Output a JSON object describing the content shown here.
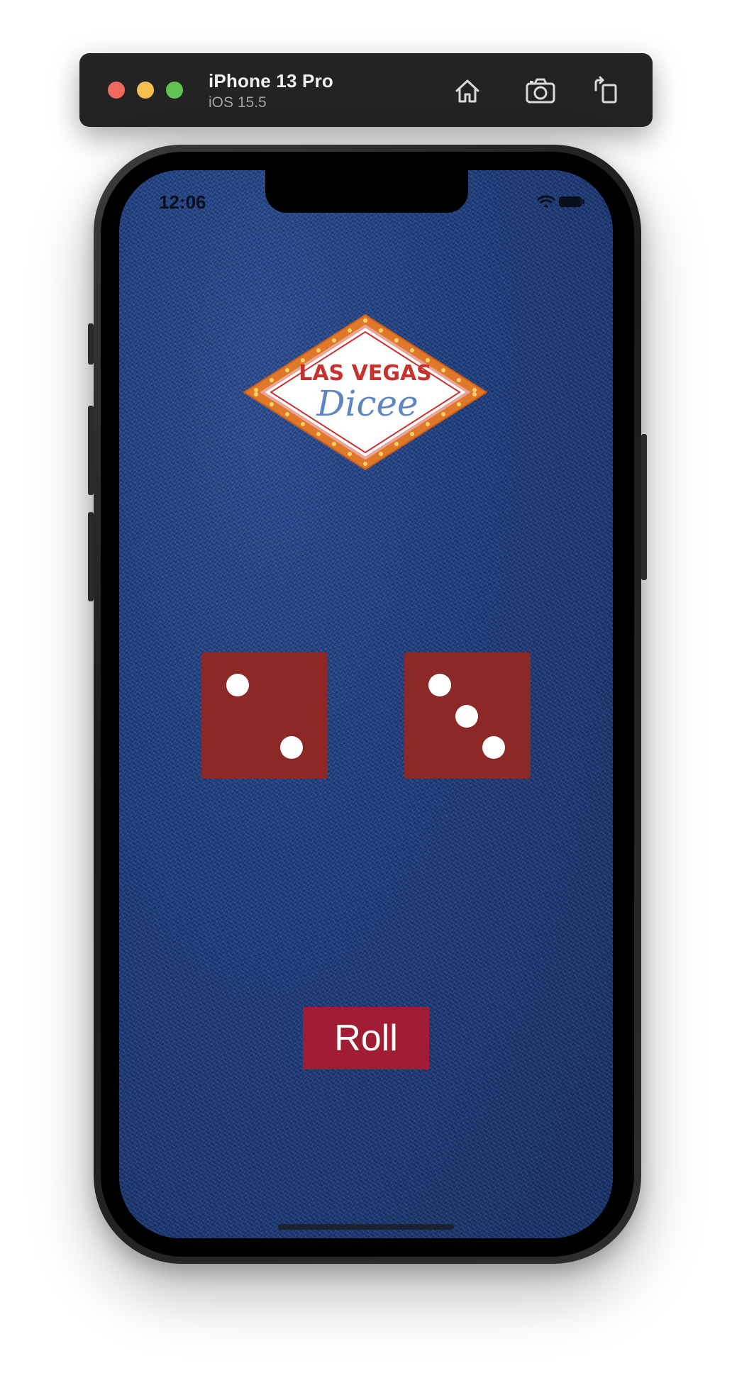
{
  "toolbar": {
    "device_name": "iPhone 13 Pro",
    "os_version": "iOS 15.5",
    "window_controls": [
      {
        "name": "close",
        "color": "#ed6a5e"
      },
      {
        "name": "minimize",
        "color": "#f5bf4f"
      },
      {
        "name": "zoom",
        "color": "#61c554"
      }
    ],
    "actions": [
      {
        "icon": "home-icon",
        "action": "Home"
      },
      {
        "icon": "camera-icon",
        "action": "Screenshot"
      },
      {
        "icon": "rotate-icon",
        "action": "Rotate"
      }
    ]
  },
  "status_bar": {
    "time": "12:06",
    "icons": [
      "wifi-icon",
      "battery-icon"
    ]
  },
  "app": {
    "logo": {
      "line1": "LAS VEGAS",
      "line2": "Dicee"
    },
    "dice": [
      {
        "value": 2,
        "color": "#8c2826"
      },
      {
        "value": 3,
        "color": "#8c2826"
      }
    ],
    "roll_button": "Roll",
    "colors": {
      "felt": "#21407f",
      "button": "#a11d33",
      "logo_red": "#c8322d",
      "logo_blue": "#5f86c4",
      "logo_orange": "#e0782a"
    }
  }
}
